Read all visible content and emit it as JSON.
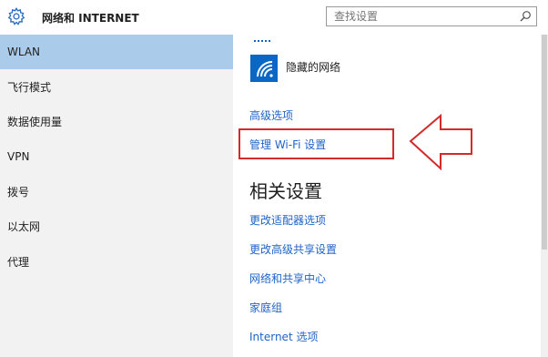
{
  "header": {
    "title": "网络和 INTERNET",
    "search_placeholder": "查找设置"
  },
  "sidebar": {
    "items": [
      {
        "label": "WLAN",
        "active": true
      },
      {
        "label": "飞行模式"
      },
      {
        "label": "数据使用量"
      },
      {
        "label": "VPN"
      },
      {
        "label": "拨号"
      },
      {
        "label": "以太网"
      },
      {
        "label": "代理"
      }
    ]
  },
  "main": {
    "hidden_network_label": "隐藏的网络",
    "advanced_options": "高级选项",
    "manage_wifi": "管理 Wi-Fi 设置",
    "related_title": "相关设置",
    "related_links": [
      "更改适配器选项",
      "更改高级共享设置",
      "网络和共享中心",
      "家庭组",
      "Internet 选项"
    ]
  },
  "colors": {
    "accent": "#1f63c8",
    "sidebar_active": "#aacbea",
    "annotation": "#d42a2a",
    "wifi_tile": "#0b67c4"
  },
  "icons": [
    "gear-icon",
    "search-icon",
    "wifi-icon",
    "arrow-left-icon"
  ]
}
